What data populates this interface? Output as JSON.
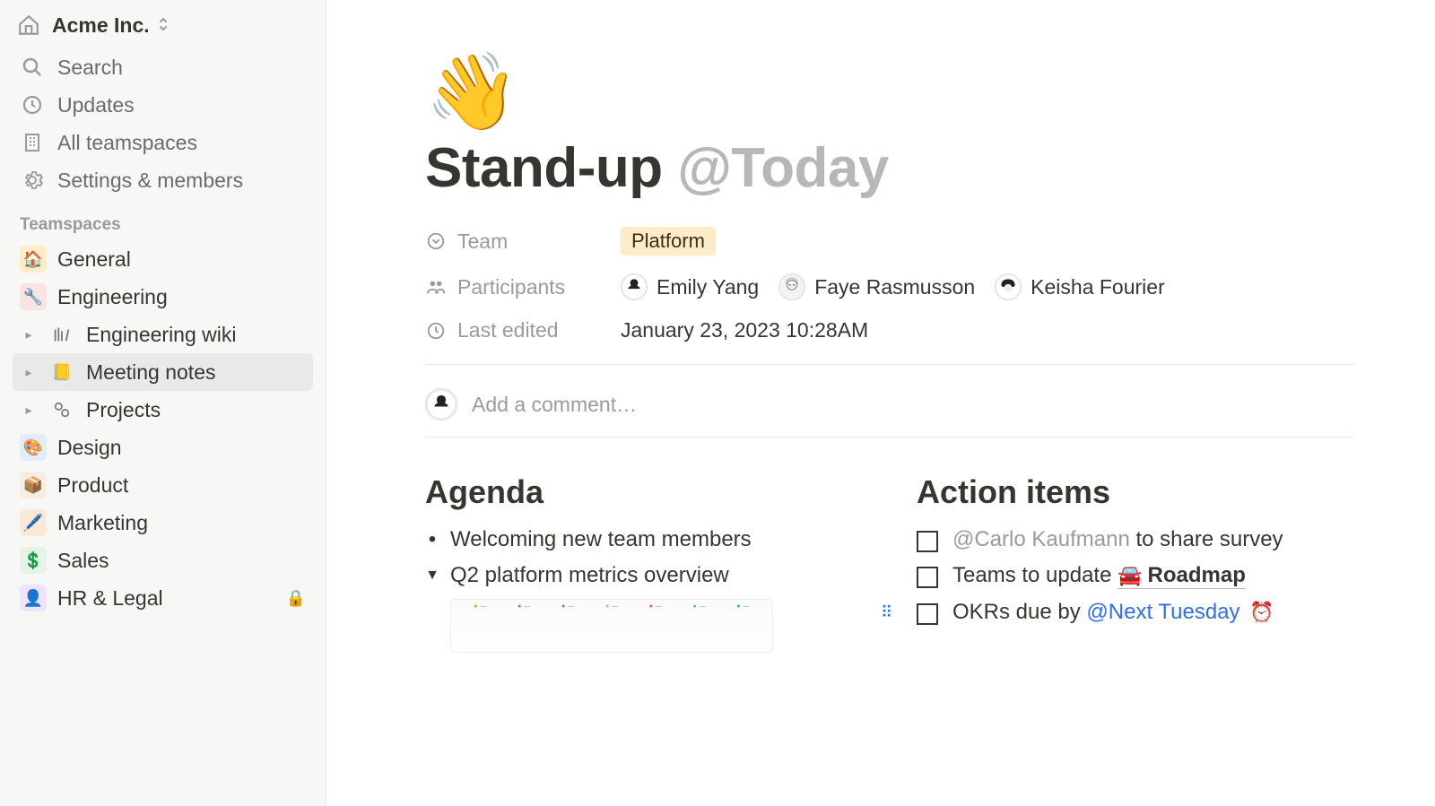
{
  "workspace": {
    "name": "Acme Inc."
  },
  "nav": {
    "search": "Search",
    "updates": "Updates",
    "all_teamspaces": "All teamspaces",
    "settings": "Settings & members"
  },
  "sidebar": {
    "section_title": "Teamspaces",
    "items": {
      "general": "General",
      "engineering": "Engineering",
      "engineering_wiki": "Engineering wiki",
      "meeting_notes": "Meeting notes",
      "projects": "Projects",
      "design": "Design",
      "product": "Product",
      "marketing": "Marketing",
      "sales": "Sales",
      "hr_legal": "HR & Legal"
    }
  },
  "page": {
    "emoji": "👋",
    "title_main": "Stand-up ",
    "title_mention": "@Today"
  },
  "properties": {
    "team_label": "Team",
    "team_value": "Platform",
    "participants_label": "Participants",
    "participants": {
      "p0": "Emily Yang",
      "p1": "Faye Rasmusson",
      "p2": "Keisha Fourier"
    },
    "last_edited_label": "Last edited",
    "last_edited_value": "January 23, 2023 10:28AM"
  },
  "comment": {
    "placeholder": "Add a comment…"
  },
  "agenda": {
    "heading": "Agenda",
    "item0": "Welcoming new team members",
    "item1": "Q2 platform metrics overview"
  },
  "action_items": {
    "heading": "Action items",
    "item0": {
      "mention": "@Carlo Kaufmann",
      "rest": " to share survey"
    },
    "item1": {
      "prefix": "Teams to update ",
      "link_emoji": "🚘",
      "link_text": "Roadmap"
    },
    "item2": {
      "prefix": "OKRs due by ",
      "mention": "@Next Tuesday",
      "alarm": "⏰"
    }
  }
}
